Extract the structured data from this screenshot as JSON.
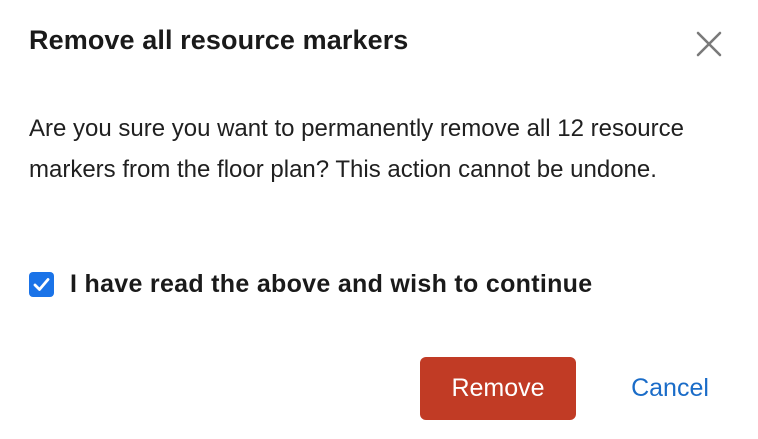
{
  "dialog": {
    "title": "Remove all resource markers",
    "close_icon": "close-icon",
    "message": "Are you sure you want to permanently remove all 12 resource markers from the floor plan? This action cannot be undone.",
    "confirm_checkbox": {
      "checked": true,
      "label": "I have read the above and wish to continue",
      "icon": "checkmark-icon"
    },
    "buttons": {
      "remove_label": "Remove",
      "cancel_label": "Cancel"
    }
  },
  "colors": {
    "remove_button": "#c13b25",
    "cancel_link": "#1a6cc8",
    "checkbox_checked": "#1a73e8",
    "close_icon": "#7a7a7a"
  }
}
